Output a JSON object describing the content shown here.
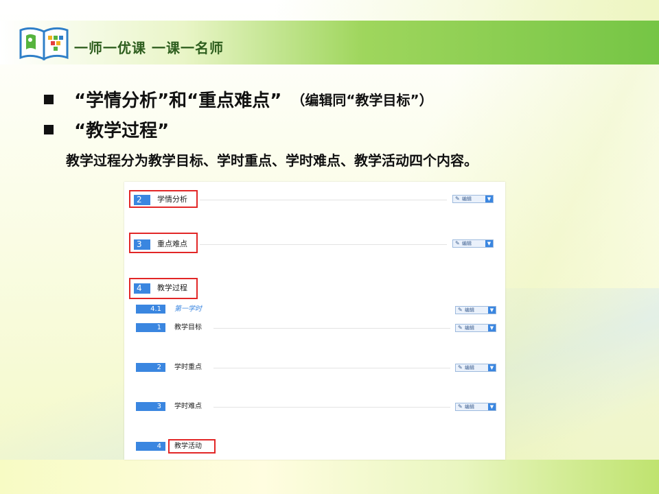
{
  "header": {
    "slogan": "一师一优课 一课一名师",
    "logo_icon": "book-logo-icon"
  },
  "bullets": [
    {
      "main": "“学情分析”和“重点难点”",
      "sub": "（编辑同“教学目标”）"
    },
    {
      "main": "“教学过程”",
      "sub": ""
    }
  ],
  "description": "教学过程分为教学目标、学时重点、学时难点、教学活动四个内容。",
  "screenshot": {
    "edit_label": "编辑",
    "sections": [
      {
        "num": "2",
        "label": "学情分析"
      },
      {
        "num": "3",
        "label": "重点难点"
      },
      {
        "num": "4",
        "label": "教学过程"
      }
    ],
    "subsection": {
      "num": "4.1",
      "label": "第一学时"
    },
    "items": [
      {
        "num": "1",
        "label": "教学目标"
      },
      {
        "num": "2",
        "label": "学时重点"
      },
      {
        "num": "3",
        "label": "学时难点"
      },
      {
        "num": "4",
        "label": "教学活动"
      }
    ]
  },
  "colors": {
    "accent_blue": "#3a86e0",
    "highlight_red": "#e22626",
    "header_green": "#75c545"
  }
}
